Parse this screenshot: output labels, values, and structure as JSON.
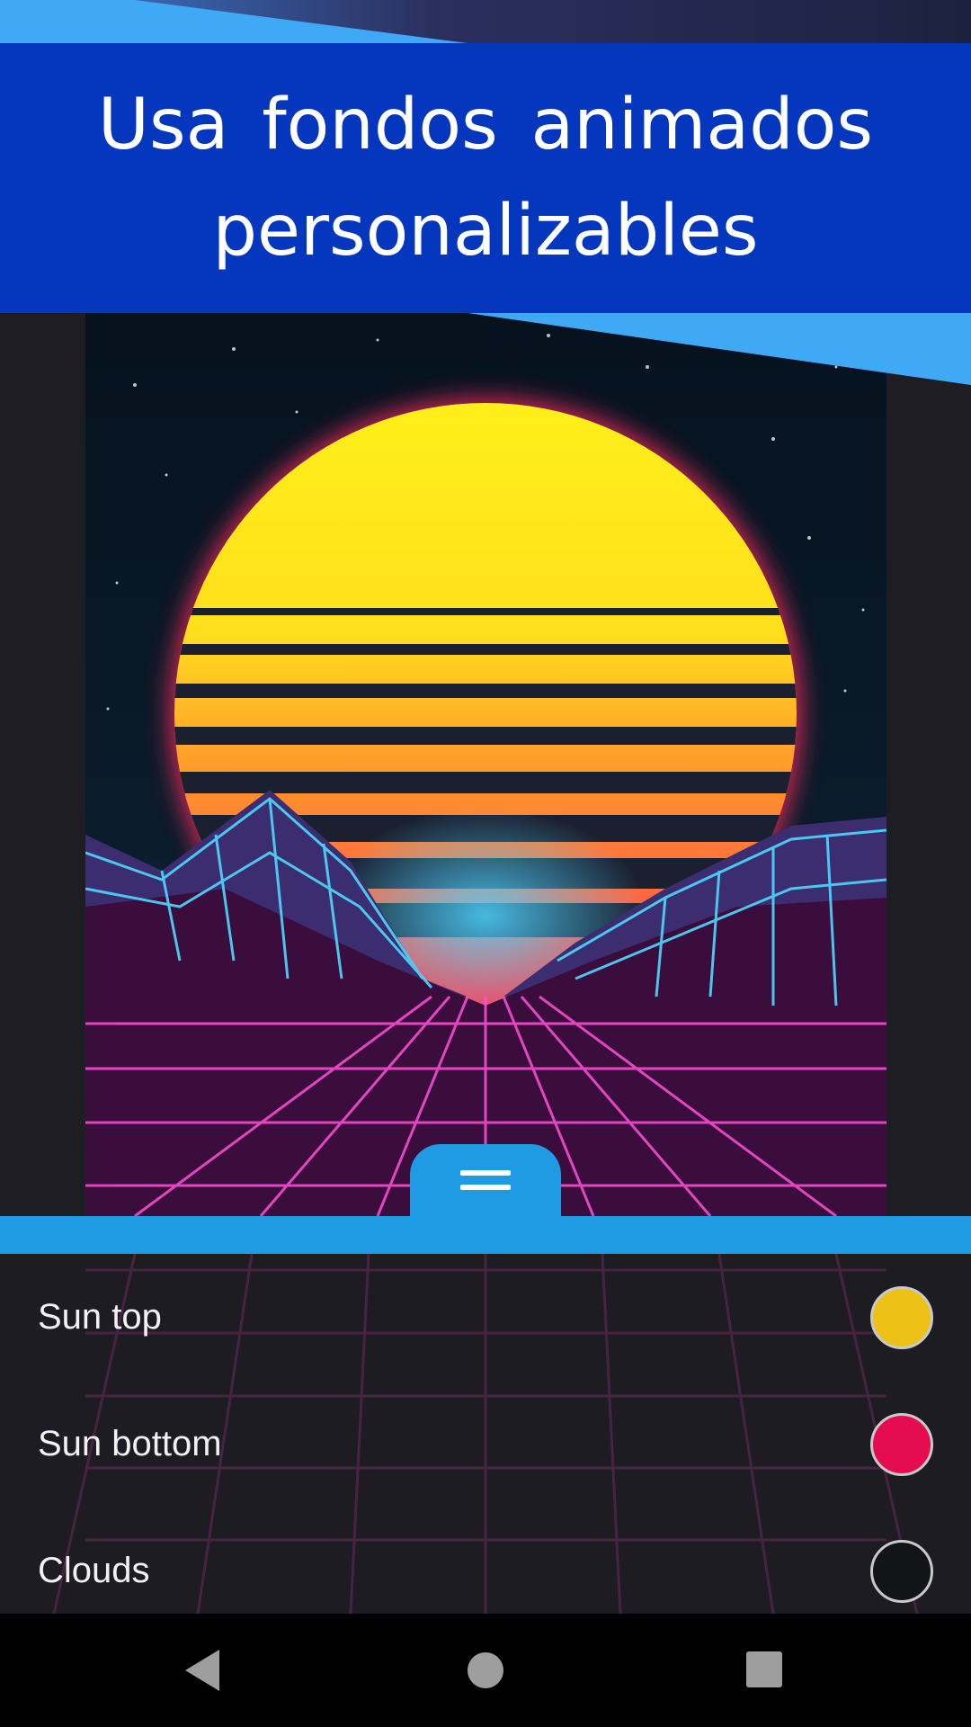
{
  "header": {
    "line1": "Usa fondos animados",
    "line2": "personalizables"
  },
  "wallpaper": {
    "sun_top_color": "#ffef1a",
    "sun_bottom_color": "#ff2b5e",
    "grid_color": "#ff4fd8",
    "mountain_grid_color": "#4fd8ff"
  },
  "settings": [
    {
      "label": "Sun top",
      "color": "#eec116"
    },
    {
      "label": "Sun bottom",
      "color": "#e60c52"
    },
    {
      "label": "Clouds",
      "color": "#121418"
    }
  ],
  "nav": {
    "back_icon": "back-triangle-icon",
    "home_icon": "home-circle-icon",
    "recents_icon": "recents-square-icon"
  },
  "colors": {
    "banner": "#0436be",
    "accent": "#1e9be3",
    "light_accent": "#3fa9f5"
  }
}
